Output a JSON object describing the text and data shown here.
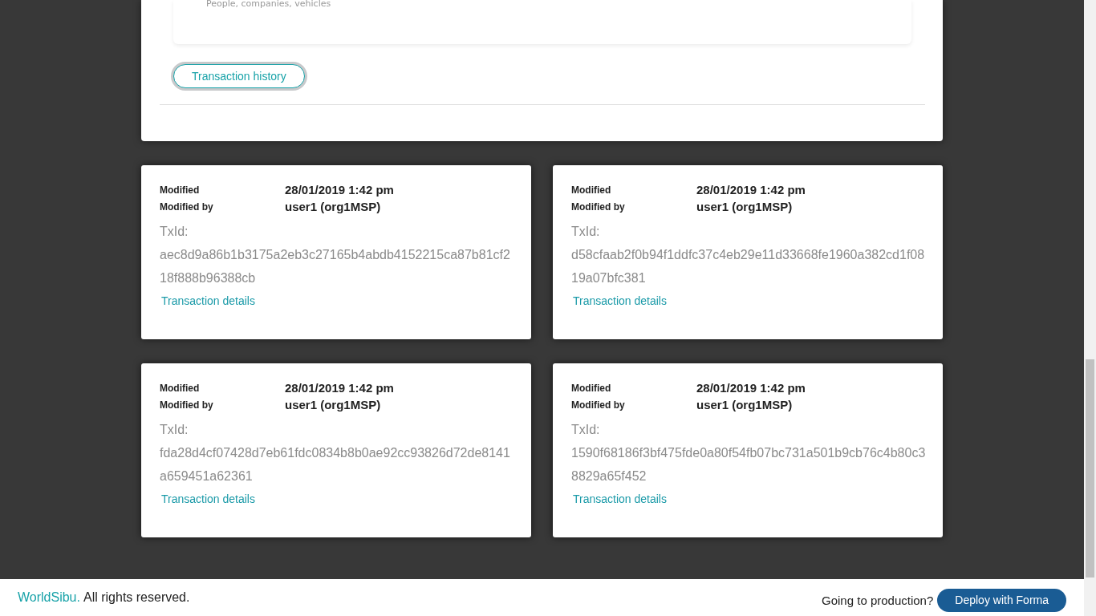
{
  "summary_card": {
    "subtitle": "People, companies, vehicles"
  },
  "history_button": {
    "label": "Transaction history"
  },
  "transactions": [
    {
      "modified_label": "Modified",
      "modified": "28/01/2019 1:42 pm",
      "modified_by_label": "Modified by",
      "modified_by": "user1 (org1MSP)",
      "txid_label": "TxId:",
      "txid": "aec8d9a86b1b3175a2eb3c27165b4abdb4152215ca87b81cf218f888b96388cb",
      "link": "Transaction details"
    },
    {
      "modified_label": "Modified",
      "modified": "28/01/2019 1:42 pm",
      "modified_by_label": "Modified by",
      "modified_by": "user1 (org1MSP)",
      "txid_label": "TxId:",
      "txid": "d58cfaab2f0b94f1ddfc37c4eb29e11d33668fe1960a382cd1f0819a07bfc381",
      "link": "Transaction details"
    },
    {
      "modified_label": "Modified",
      "modified": "28/01/2019 1:42 pm",
      "modified_by_label": "Modified by",
      "modified_by": "user1 (org1MSP)",
      "txid_label": "TxId:",
      "txid": "fda28d4cf07428d7eb61fdc0834b8b0ae92cc93826d72de8141a659451a62361",
      "link": "Transaction details"
    },
    {
      "modified_label": "Modified",
      "modified": "28/01/2019 1:42 pm",
      "modified_by_label": "Modified by",
      "modified_by": "user1 (org1MSP)",
      "txid_label": "TxId:",
      "txid": "1590f68186f3bf475fde0a80f54fb07bc731a501b9cb76c4b80c38829a65f452",
      "link": "Transaction details"
    }
  ],
  "footer": {
    "brand": "WorldSibu.",
    "rights": "All rights reserved.",
    "question": "Going to production?",
    "button": "Deploy with Forma"
  }
}
